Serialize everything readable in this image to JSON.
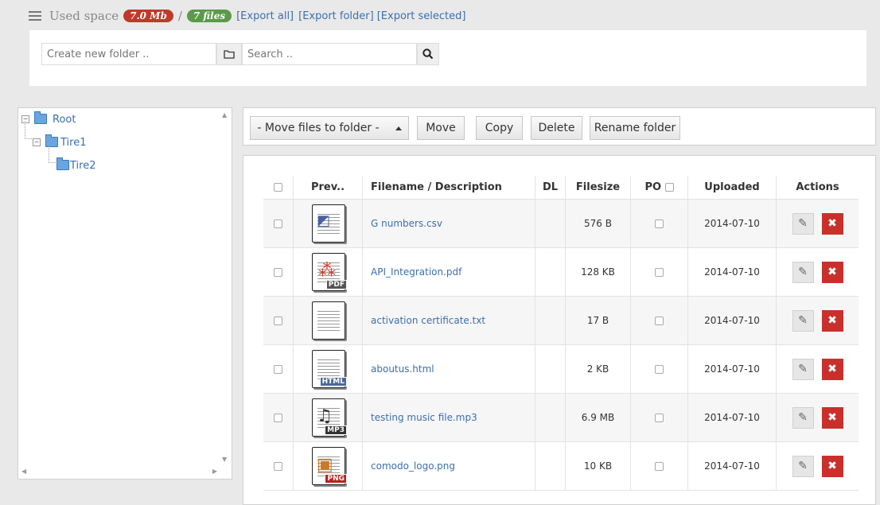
{
  "topbar": {
    "used_label": "Used space",
    "size_badge": "7.0 Mb",
    "separator": "/",
    "files_badge": "7 files",
    "export_all": "[Export all]",
    "export_folder": "[Export folder]",
    "export_selected": "[Export selected]"
  },
  "search": {
    "new_folder_placeholder": "Create new folder ..",
    "search_placeholder": "Search .."
  },
  "tree": {
    "root": "Root",
    "tire1": "Tire1",
    "tire2": "Tire2"
  },
  "toolbar": {
    "move_dropdown": "- Move files to folder -",
    "move": "Move",
    "copy": "Copy",
    "delete": "Delete",
    "rename": "Rename folder"
  },
  "table": {
    "headers": {
      "preview": "Prev..",
      "filename": "Filename / Description",
      "dl": "DL",
      "filesize": "Filesize",
      "po": "PO",
      "uploaded": "Uploaded",
      "actions": "Actions"
    },
    "rows": [
      {
        "name": "G numbers.csv",
        "size": "576 B",
        "date": "2014-07-10",
        "type": "csv"
      },
      {
        "name": "API_Integration.pdf",
        "size": "128 KB",
        "date": "2014-07-10",
        "type": "pdf",
        "tag": "PDF"
      },
      {
        "name": "activation certificate.txt",
        "size": "17 B",
        "date": "2014-07-10",
        "type": "txt"
      },
      {
        "name": "aboutus.html",
        "size": "2 KB",
        "date": "2014-07-10",
        "type": "html",
        "tag": "HTML"
      },
      {
        "name": "testing music file.mp3",
        "size": "6.9 MB",
        "date": "2014-07-10",
        "type": "mp3",
        "tag": "MP3"
      },
      {
        "name": "comodo_logo.png",
        "size": "10 KB",
        "date": "2014-07-10",
        "type": "png",
        "tag": "PNG"
      }
    ]
  },
  "icons": {
    "edit": "pencil-icon",
    "delete": "close-icon"
  }
}
